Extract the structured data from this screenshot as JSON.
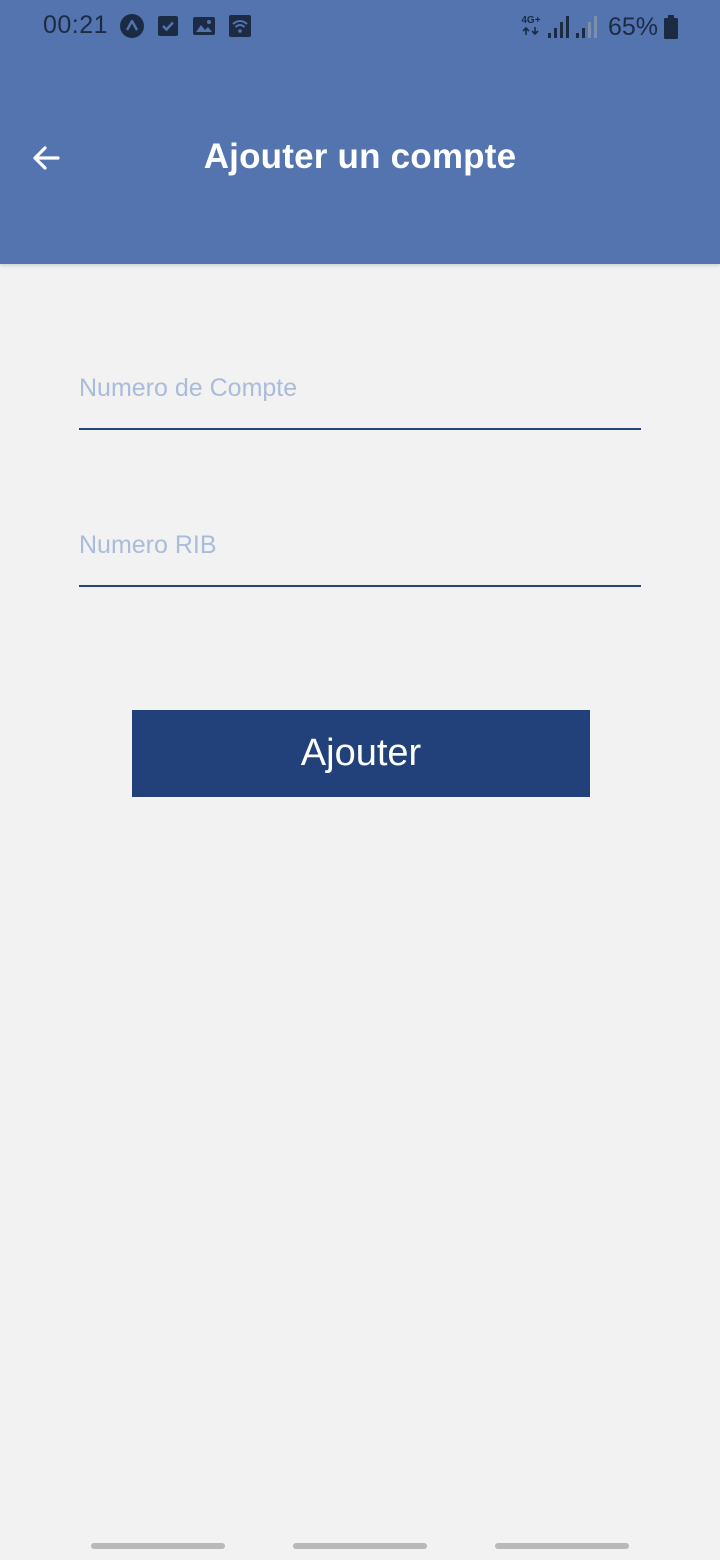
{
  "status_bar": {
    "time": "00:21",
    "icons": [
      "app-a-icon",
      "checkbox-icon",
      "image-icon",
      "wifi-icon"
    ],
    "network_label": "4G+",
    "battery_percent": "65%"
  },
  "app_bar": {
    "title": "Ajouter un compte",
    "back_icon": "arrow-left-icon"
  },
  "form": {
    "account_number": {
      "placeholder": "Numero de Compte",
      "value": ""
    },
    "rib_number": {
      "placeholder": "Numero RIB",
      "value": ""
    },
    "submit_label": "Ajouter"
  },
  "colors": {
    "header": "#5474af",
    "button": "#22417a",
    "underline": "#25447a",
    "placeholder": "#a9bcda",
    "background": "#f2f2f2"
  }
}
